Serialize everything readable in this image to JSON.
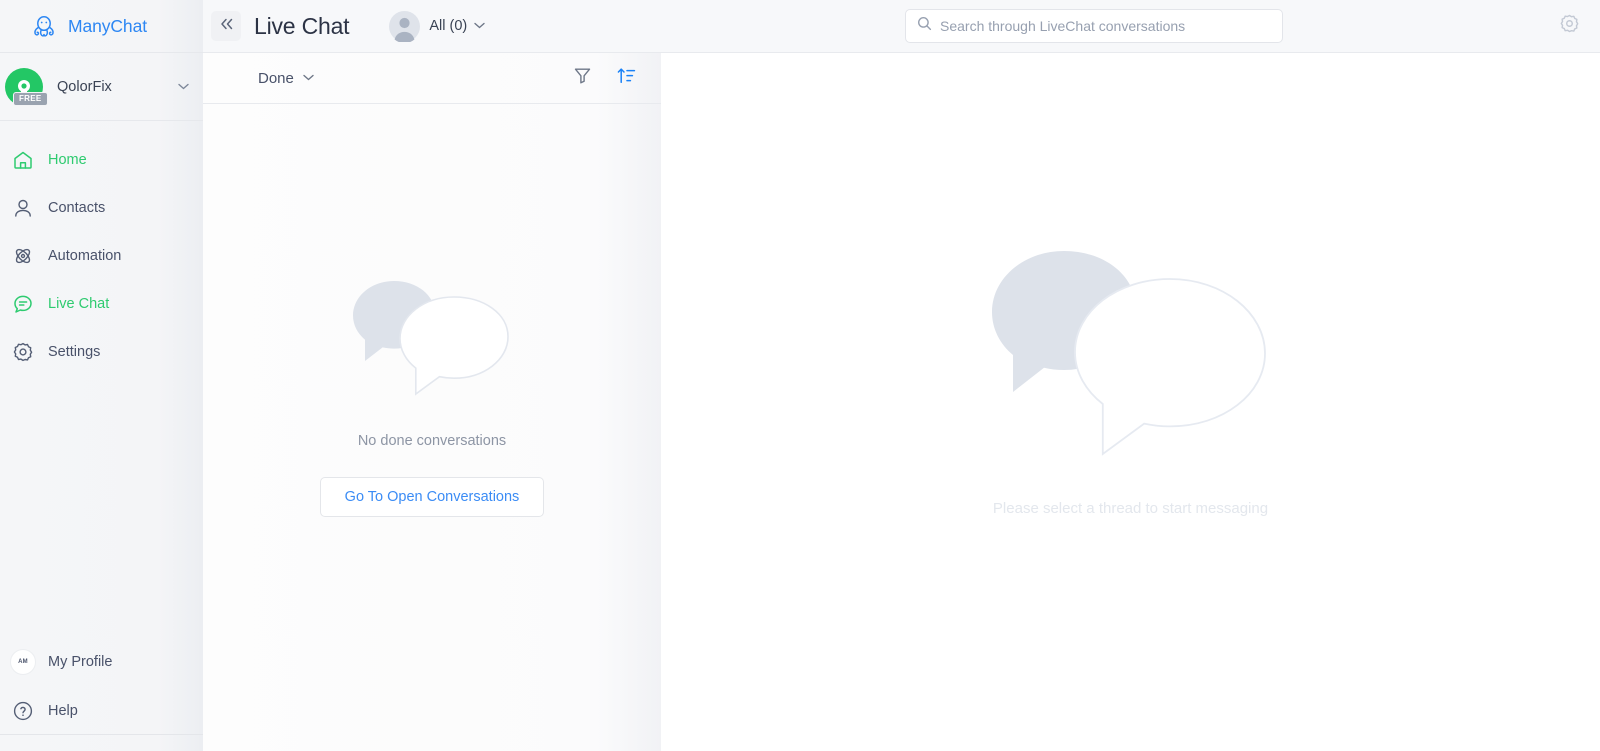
{
  "brand": {
    "name": "ManyChat",
    "logo_icon": "octopus-logo-icon",
    "color": "#2d87f3"
  },
  "account": {
    "name": "QolorFix",
    "plan_badge": "FREE",
    "avatar_icon": "account-avatar-icon",
    "caret_icon": "chevron-down-icon"
  },
  "sidebar": {
    "items": [
      {
        "label": "Home",
        "icon": "home-icon",
        "active": true
      },
      {
        "label": "Contacts",
        "icon": "user-icon",
        "active": false
      },
      {
        "label": "Automation",
        "icon": "atom-icon",
        "active": false
      },
      {
        "label": "Live Chat",
        "icon": "chat-bubble-icon",
        "active": true
      },
      {
        "label": "Settings",
        "icon": "gear-icon",
        "active": false
      }
    ],
    "bottom_items": [
      {
        "label": "My Profile",
        "icon": "profile-avatar-icon",
        "initials": "AM"
      },
      {
        "label": "Help",
        "icon": "help-circle-icon"
      }
    ]
  },
  "topbar": {
    "collapse_icon": "double-chevron-left-icon",
    "title": "Live Chat",
    "thread_filter_label": "All (0)",
    "thread_filter_avatar": "person-avatar-icon",
    "thread_filter_caret": "chevron-down-icon",
    "settings_icon": "gear-icon"
  },
  "search": {
    "placeholder": "Search through LiveChat conversations",
    "value": "",
    "icon": "search-icon"
  },
  "list_toolbar": {
    "status_filter": "Done",
    "status_caret": "chevron-down-icon",
    "filter_icon": "funnel-filter-icon",
    "sort_icon": "sort-ascending-icon"
  },
  "list_empty": {
    "illustration": "speech-bubbles-illustration",
    "message": "No done conversations",
    "button_label": "Go To Open Conversations"
  },
  "thread_empty": {
    "illustration": "speech-bubbles-illustration",
    "message": "Please select a thread to start messaging"
  },
  "colors": {
    "accent_green": "#2ecb70",
    "accent_blue": "#3b8cf5",
    "brand_blue": "#2d87f3",
    "text_dark": "#3a4354",
    "text_muted": "#8d95a4"
  }
}
